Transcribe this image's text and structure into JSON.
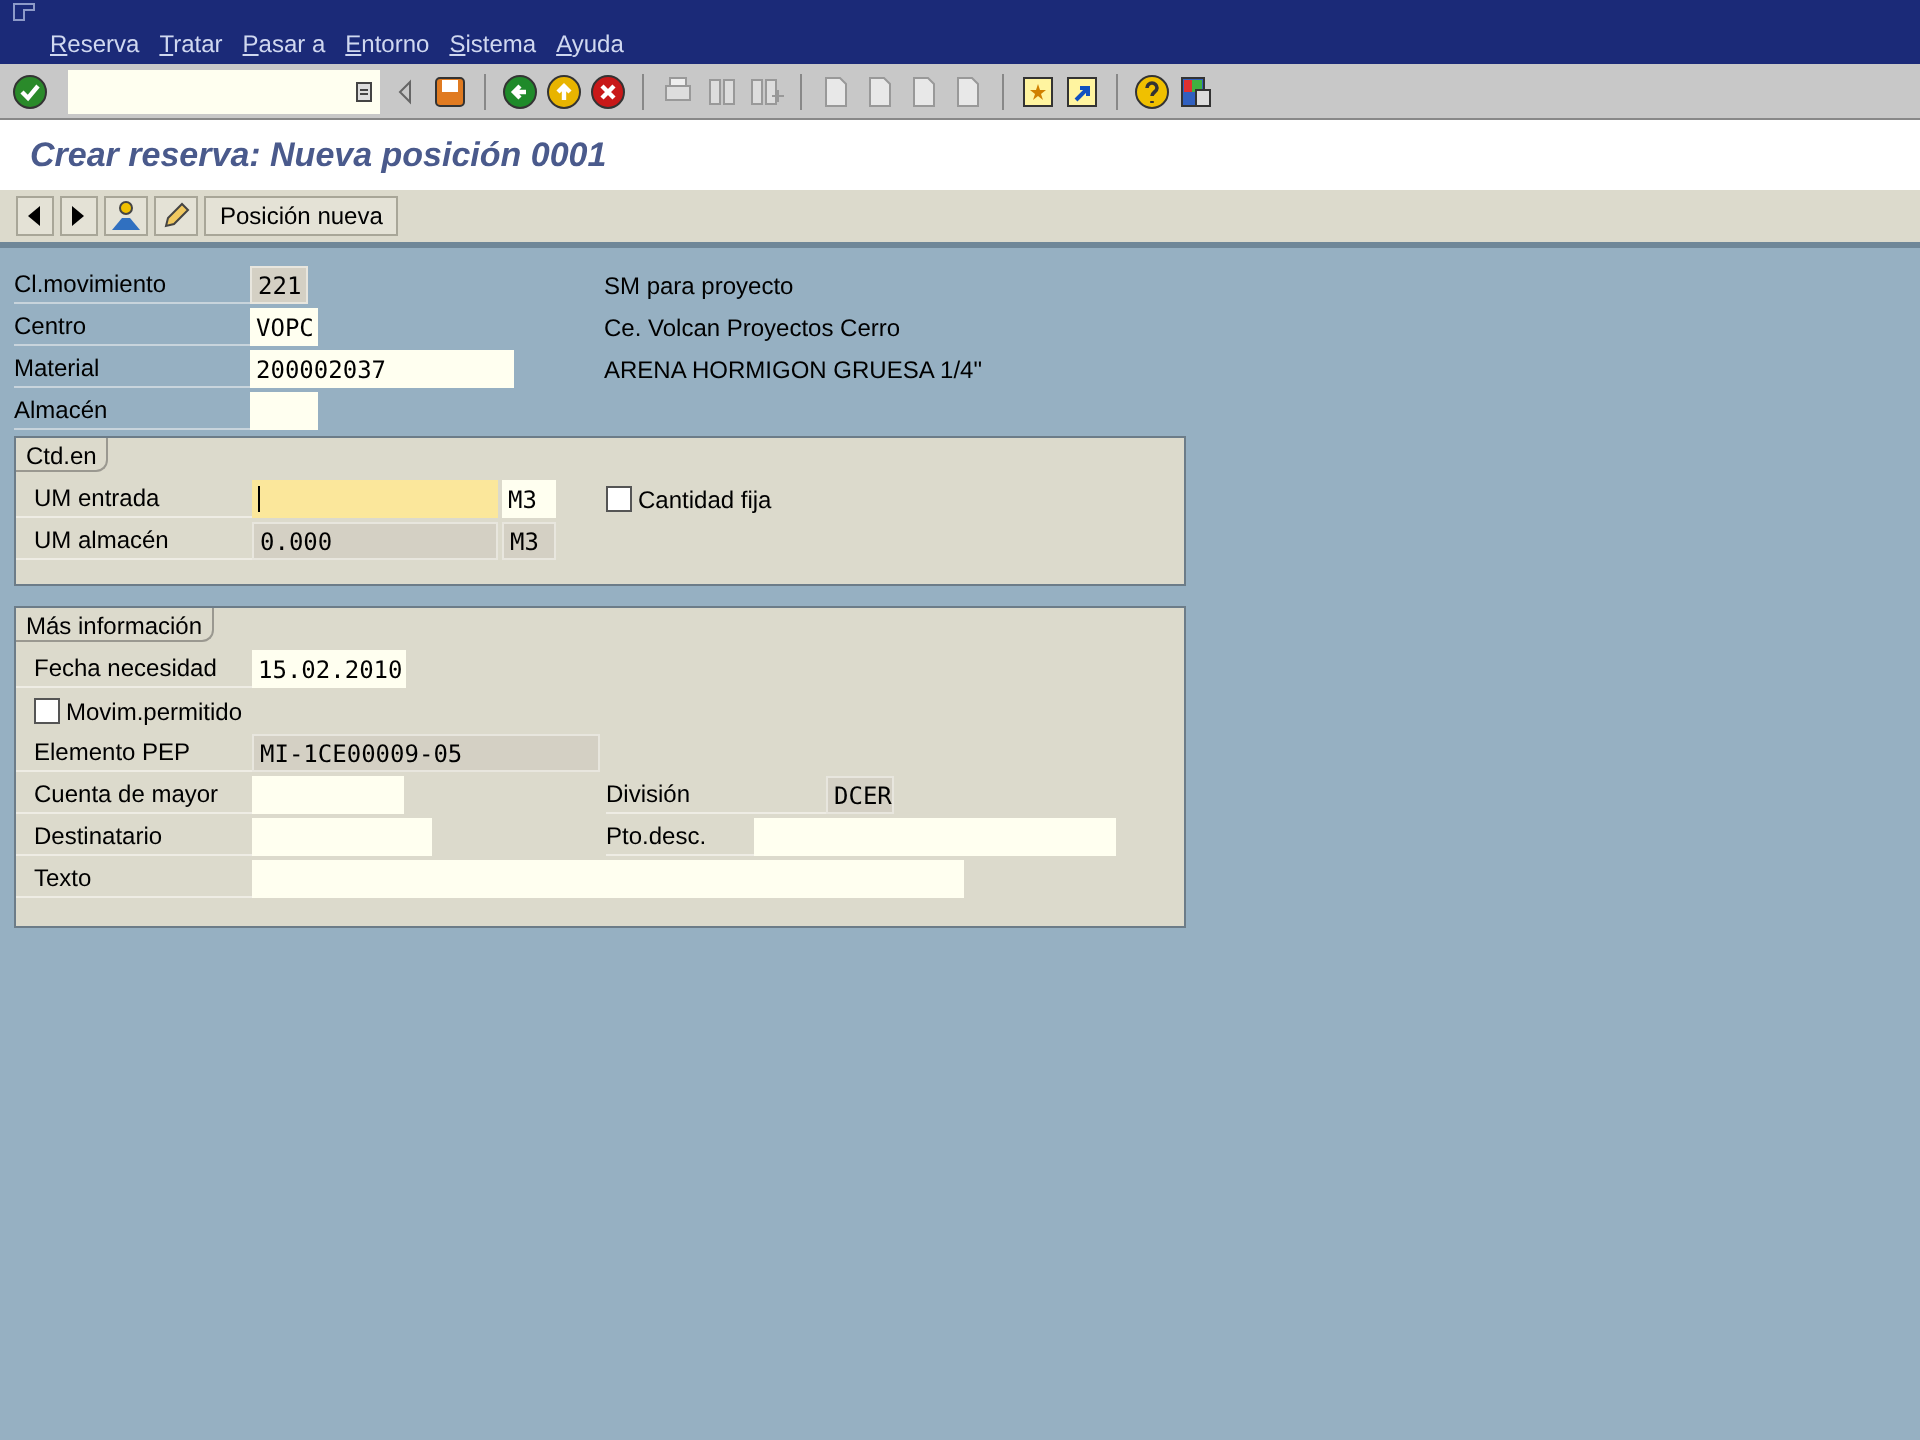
{
  "menu": [
    "Reserva",
    "Tratar",
    "Pasar a",
    "Entorno",
    "Sistema",
    "Ayuda"
  ],
  "title": "Crear reserva: Nueva posición 0001",
  "app_toolbar": {
    "button": "Posición nueva"
  },
  "header_fields": [
    {
      "label": "Cl.movimiento",
      "value": "221",
      "kind": "display",
      "description": "SM para proyecto"
    },
    {
      "label": "Centro",
      "value": "VOPC",
      "kind": "input",
      "description": "Ce. Volcan Proyectos Cerro"
    },
    {
      "label": "Material",
      "value": "200002037",
      "kind": "input",
      "description": "ARENA HORMIGON GRUESA 1/4\""
    },
    {
      "label": "Almacén",
      "kind": "input"
    }
  ],
  "quantity_group": {
    "title": "Ctd.en",
    "rows": [
      {
        "label": "UM entrada",
        "kind": "focused",
        "unit": "M3",
        "unit_disabled": false
      },
      {
        "label": "UM almacén",
        "value": "0.000",
        "kind": "display",
        "unit": "M3",
        "unit_disabled": true
      }
    ],
    "checkbox": {
      "label": "Cantidad fija",
      "checked": false
    }
  },
  "more_group": {
    "title": "Más información",
    "date": {
      "label": "Fecha necesidad",
      "value": "15.02.2010",
      "kind": "input"
    },
    "checkbox": {
      "label": "Movim.permitido",
      "checked": false
    },
    "wbs": {
      "label": "Elemento PEP",
      "value": "MI-1CE00009-05",
      "kind": "display"
    },
    "gl_account": {
      "label": "Cuenta de mayor",
      "kind": "input"
    },
    "division": {
      "label": "División",
      "value": "DCER",
      "kind": "display"
    },
    "recipient": {
      "label": "Destinatario",
      "kind": "input"
    },
    "unloading": {
      "label": "Pto.desc.",
      "kind": "input"
    },
    "text": {
      "label": "Texto",
      "kind": "input"
    }
  }
}
